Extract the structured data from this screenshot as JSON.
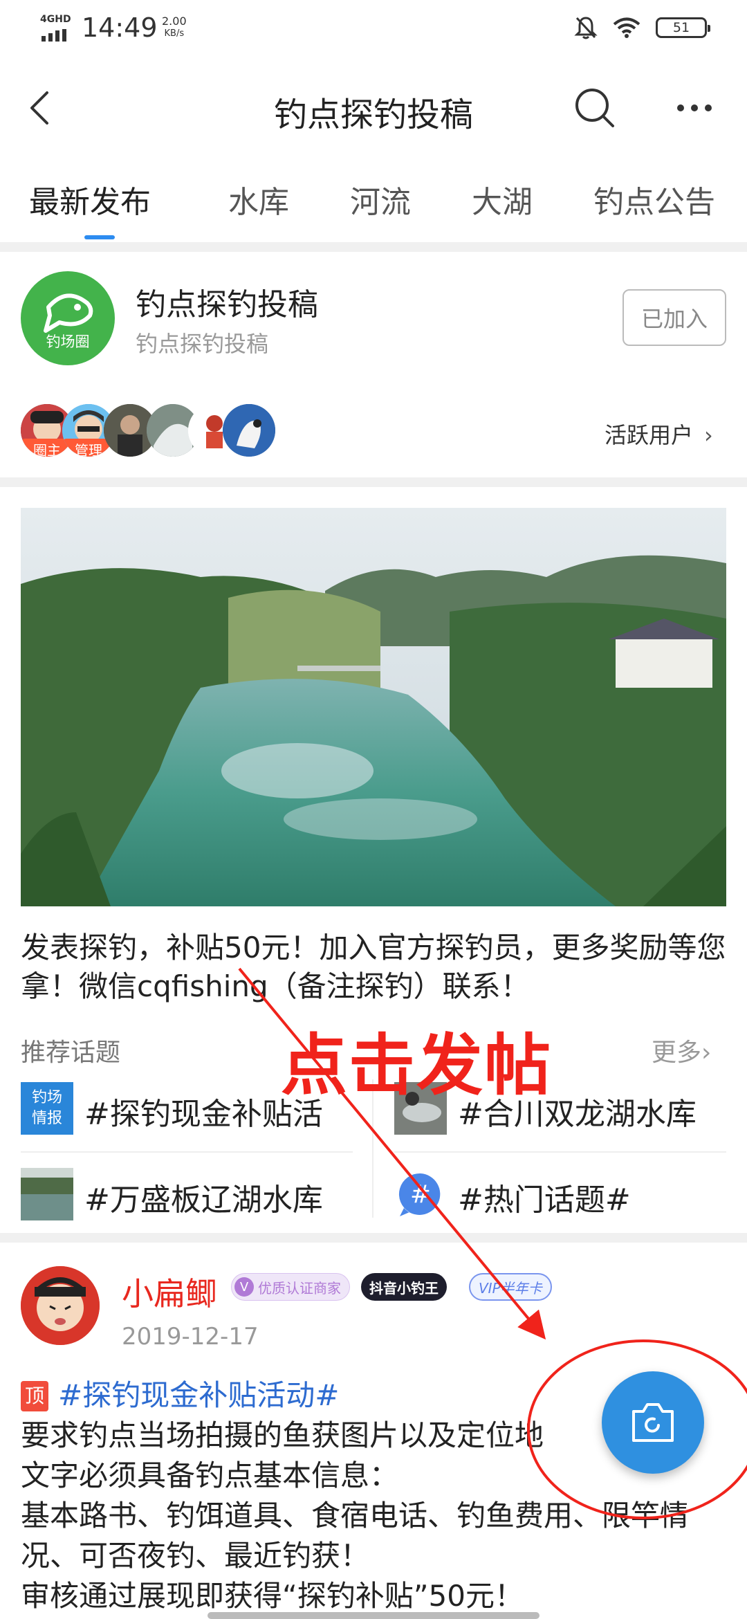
{
  "status_bar": {
    "network": "4GHD",
    "time": "14:49",
    "speed_value": "2.00",
    "speed_unit": "KB/s",
    "battery": "51"
  },
  "nav": {
    "title": "钓点探钓投稿",
    "back_icon": "back-arrow-icon",
    "search_icon": "search-icon",
    "more_icon": "more-icon"
  },
  "tabs": [
    {
      "label": "最新发布",
      "active": true
    },
    {
      "label": "水库",
      "active": false
    },
    {
      "label": "河流",
      "active": false
    },
    {
      "label": "大湖",
      "active": false
    },
    {
      "label": "钓点公告",
      "active": false
    }
  ],
  "circle": {
    "logo_text": "钓场圈",
    "name": "钓点探钓投稿",
    "subtitle": "钓点探钓投稿",
    "joined_label": "已加入",
    "avatar_badges": [
      "圈主",
      "管理"
    ],
    "active_users_label": "活跃用户",
    "active_users_chevron": "›"
  },
  "notice": "发表探钓，补贴50元！加入官方探钓员，更多奖励等您拿！微信cqfishing（备注探钓）联系！",
  "recommended": {
    "label": "推荐话题",
    "more": "更多",
    "more_chevron": "›",
    "topics": [
      {
        "name": "#探钓现金补贴活",
        "thumb_text_1": "钓场",
        "thumb_text_2": "情报"
      },
      {
        "name": "#合川双龙湖水库"
      },
      {
        "name": "#万盛板辽湖水库"
      },
      {
        "name": "#热门话题#",
        "thumb_text": "#"
      }
    ]
  },
  "post": {
    "username": "小扁鲫",
    "badge_verified_mark": "V",
    "badge_verified": "优质认证商家",
    "badge_douyin": "抖音小钓王",
    "badge_vip": "VIP半年卡",
    "date": "2019-12-17",
    "pin_label": "顶",
    "topic": "#探钓现金补贴活动#",
    "lines": [
      "要求钓点当场拍摄的鱼获图片以及定位地",
      "文字必须具备钓点基本信息：",
      "基本路书、钓饵道具、食宿电话、钓鱼费用、限竿情况、可否夜钓、最近钓获！",
      "审核通过展现即获得“探钓补贴”50元！"
    ]
  },
  "annotation": {
    "text": "点击发帖",
    "color": "#f0231b"
  },
  "fab": {
    "icon": "camera-icon"
  },
  "colors": {
    "accent": "#2d8cf0",
    "fab": "#2f90e0",
    "username": "#e8281f"
  }
}
